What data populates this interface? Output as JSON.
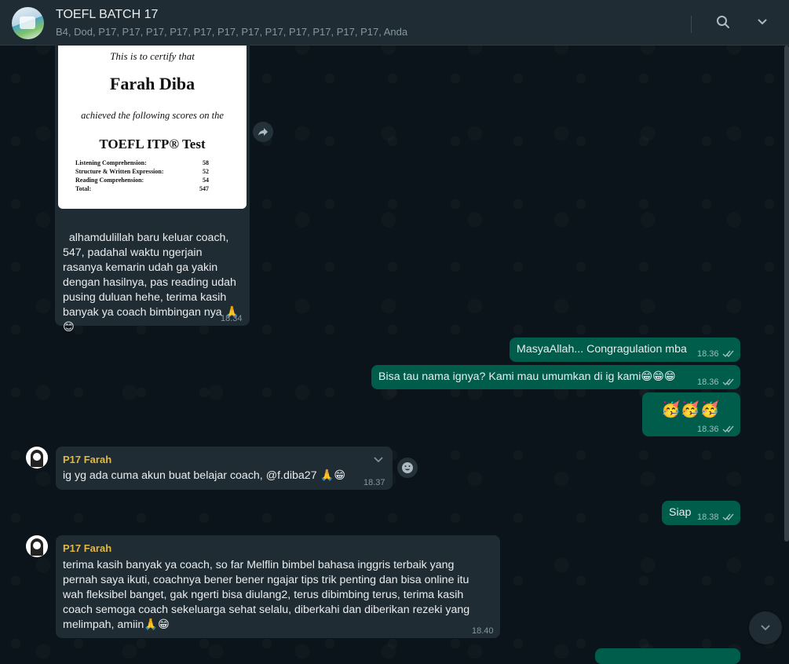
{
  "header": {
    "title": "TOEFL BATCH 17",
    "members": "B4, Dod, P17, P17, P17, P17, P17, P17, P17, P17, P17, P17, P17, P17, Anda"
  },
  "certificate": {
    "line1": "This is to certify that",
    "name": "Farah Diba",
    "line3": "achieved the following scores on the",
    "test": "TOEFL ITP® Test",
    "scores": [
      {
        "label": "Listening Comprehension:",
        "value": "58"
      },
      {
        "label": "Structure & Written Expression:",
        "value": "52"
      },
      {
        "label": "Reading Comprehension:",
        "value": "54"
      },
      {
        "label": "Total:",
        "value": "547"
      }
    ]
  },
  "messages": {
    "m1": {
      "text": "alhamdulillah baru keluar coach, 547, padahal waktu ngerjain rasanya kemarin udah ga yakin dengan hasilnya, pas reading udah pusing duluan hehe, terima kasih banyak ya coach bimbingan nya 🙏",
      "emoji": "😊",
      "time": "18.34"
    },
    "m2": {
      "text": "MasyaAllah... Congragulation mba",
      "time": "18.36"
    },
    "m3": {
      "text": "Bisa tau nama ignya? Kami mau umumkan di ig kami😁😁😁",
      "time": "18.36"
    },
    "m4": {
      "text": "🥳🥳🥳",
      "time": "18.36"
    },
    "m5": {
      "sender": "P17 Farah",
      "text": "ig yg ada cuma akun buat belajar coach, @f.diba27 🙏😁",
      "time": "18.37"
    },
    "m6": {
      "text": "Siap",
      "time": "18.38"
    },
    "m7": {
      "sender": "P17 Farah",
      "text": "terima kasih banyak ya coach, so far Melflin bimbel bahasa inggris terbaik yang pernah saya ikuti, coachnya bener bener ngajar tips trik penting dan bisa online itu wah fleksibel banget, gak ngerti bisa diulang2, terus dibimbing terus, terima kasih coach semoga coach sekeluarga sehat selalu, diberkahi dan diberikan rezeki yang melimpah, amiin🙏😁",
      "time": "18.40"
    }
  },
  "colors": {
    "background": "#0b141a",
    "header": "#202c33",
    "incoming": "#202c33",
    "outgoing": "#005c4b",
    "sender_name": "#e2b844",
    "read_ticks": "#53bdeb"
  },
  "icons": [
    "search-icon",
    "chevron-down-icon",
    "forward-icon",
    "emoji-reaction-icon",
    "double-check-icon"
  ]
}
